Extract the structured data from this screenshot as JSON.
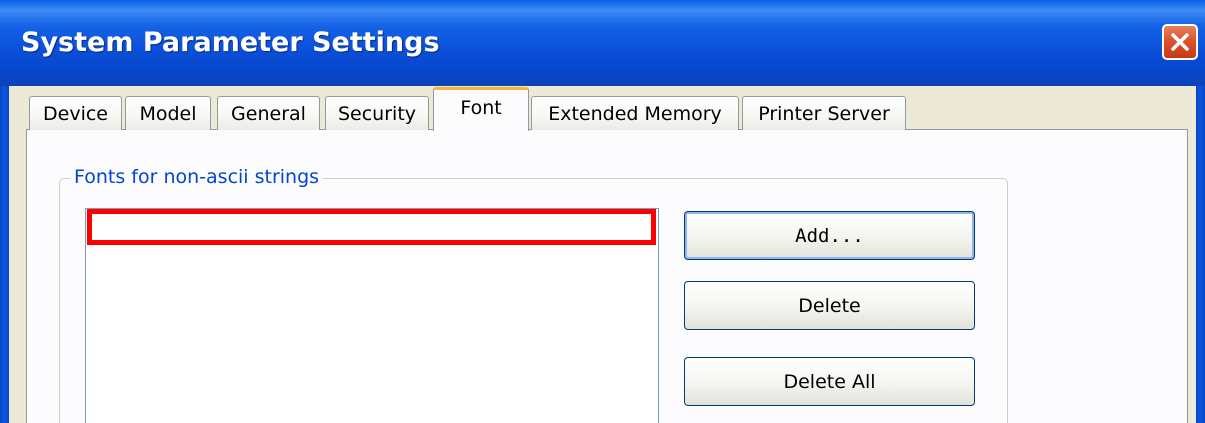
{
  "window": {
    "title": "System Parameter Settings"
  },
  "tabs": [
    {
      "label": "Device"
    },
    {
      "label": "Model"
    },
    {
      "label": "General"
    },
    {
      "label": "Security"
    },
    {
      "label": "Font",
      "active": true
    },
    {
      "label": "Extended Memory"
    },
    {
      "label": "Printer Server"
    }
  ],
  "font_panel": {
    "group_label": "Fonts for non-ascii strings",
    "buttons": {
      "add_label": "Add...",
      "delete_label": "Delete",
      "delete_all_label": "Delete All"
    }
  },
  "colors": {
    "title_bar": "#0a4fd8",
    "active_tab_accent": "#f5b43c",
    "group_label_text": "#0046d5",
    "selection_highlight": "#ff0000"
  },
  "icons": {
    "close": "close-icon"
  }
}
